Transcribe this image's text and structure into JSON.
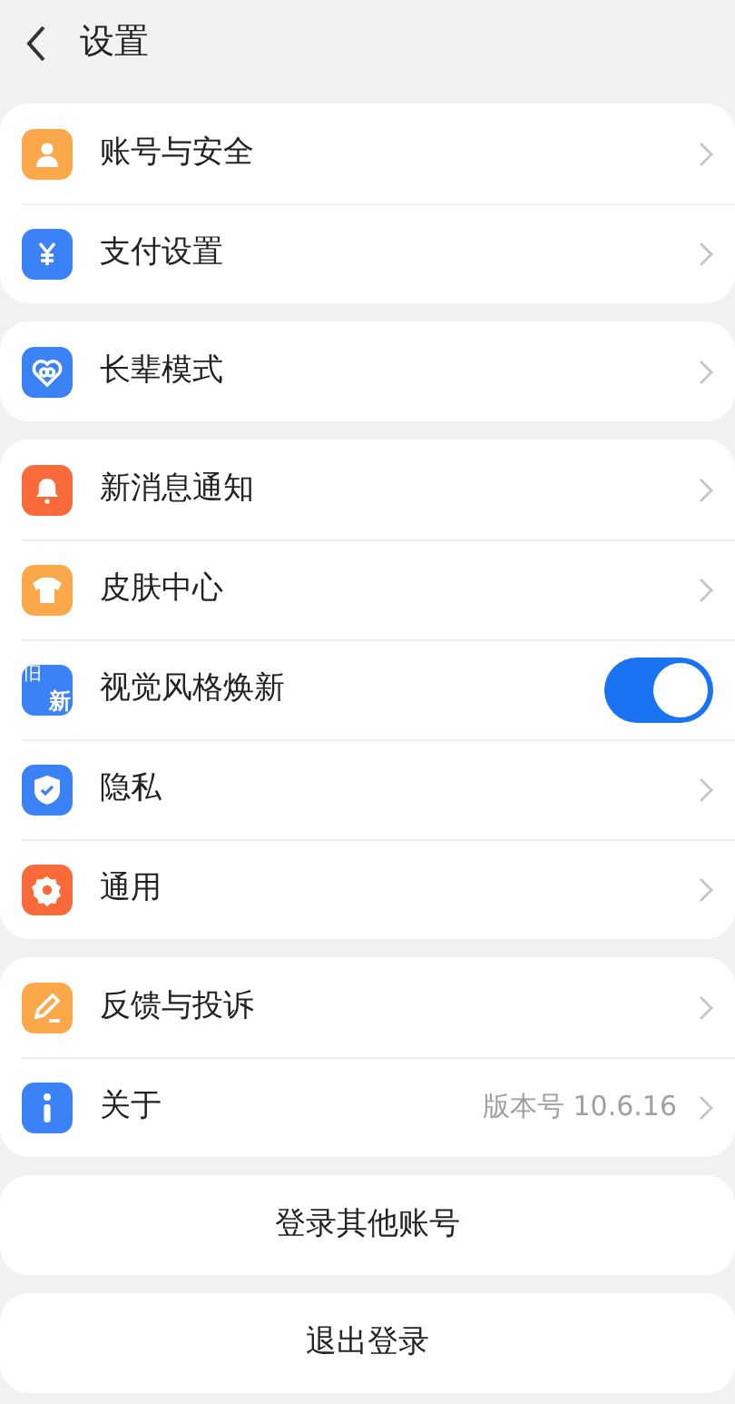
{
  "header": {
    "title": "设置"
  },
  "groups": [
    {
      "items": [
        {
          "kind": "link",
          "label": "账号与安全",
          "color": "#fba84a"
        },
        {
          "kind": "link",
          "label": "支付设置",
          "color": "#3a82f6"
        }
      ]
    },
    {
      "items": [
        {
          "kind": "link",
          "label": "长辈模式",
          "color": "#3a82f6"
        }
      ]
    },
    {
      "items": [
        {
          "kind": "link",
          "label": "新消息通知",
          "color": "#f86a3a"
        },
        {
          "kind": "link",
          "label": "皮肤中心",
          "color": "#fba84a"
        },
        {
          "kind": "toggle",
          "label": "视觉风格焕新",
          "color": "#3a82f6",
          "on": true,
          "icon_text": [
            "旧",
            "新"
          ]
        },
        {
          "kind": "link",
          "label": "隐私",
          "color": "#3a82f6"
        },
        {
          "kind": "link",
          "label": "通用",
          "color": "#f86a3a"
        }
      ]
    },
    {
      "items": [
        {
          "kind": "link",
          "label": "反馈与投诉",
          "color": "#fba84a"
        },
        {
          "kind": "link",
          "label": "关于",
          "color": "#3a82f6",
          "value": "版本号 10.6.16"
        }
      ]
    }
  ],
  "buttons": [
    "登录其他账号",
    "退出登录"
  ]
}
